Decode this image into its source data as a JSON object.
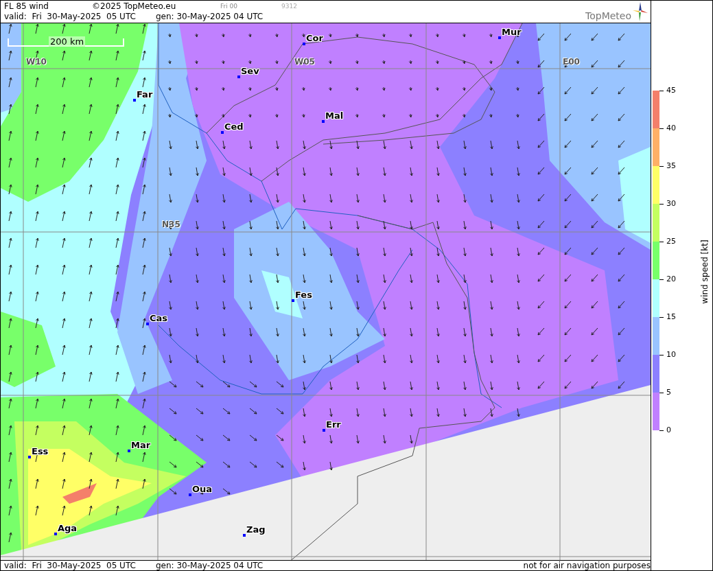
{
  "header": {
    "title": "FL 85 wind",
    "copyright": "©2025 TopMeteo.eu",
    "run": "Fri 00",
    "code": "9312",
    "valid": "valid:  Fri  30-May-2025  05 UTC",
    "generated": "gen: 30-May-2025 04 UTC",
    "logo": "TopMeteo"
  },
  "map": {
    "scale": "200 km",
    "grid_labels": [
      "W10",
      "W05",
      "E00",
      "N35"
    ],
    "cities": [
      {
        "name": "Cor"
      },
      {
        "name": "Mur"
      },
      {
        "name": "Sev"
      },
      {
        "name": "Far"
      },
      {
        "name": "Mal"
      },
      {
        "name": "Ced"
      },
      {
        "name": "Fes"
      },
      {
        "name": "Cas"
      },
      {
        "name": "Err"
      },
      {
        "name": "Mar"
      },
      {
        "name": "Ess"
      },
      {
        "name": "Oua"
      },
      {
        "name": "Aga"
      },
      {
        "name": "Zag"
      }
    ]
  },
  "legend": {
    "title": "wind speed [kt]",
    "ticks": [
      "45",
      "40",
      "35",
      "30",
      "25",
      "20",
      "15",
      "10",
      "5",
      "0"
    ],
    "bins": [
      {
        "color": "#f47f6a"
      },
      {
        "color": "#ffb066"
      },
      {
        "color": "#ffff66"
      },
      {
        "color": "#c4ff60"
      },
      {
        "color": "#78ff6a"
      },
      {
        "color": "#b0ffff"
      },
      {
        "color": "#99c4ff"
      },
      {
        "color": "#8c80ff"
      },
      {
        "color": "#c080ff"
      }
    ]
  },
  "footer": {
    "valid": "valid:  Fri  30-May-2025  05 UTC",
    "generated": "gen: 30-May-2025 04 UTC",
    "note": "not for air navigation purposes"
  }
}
